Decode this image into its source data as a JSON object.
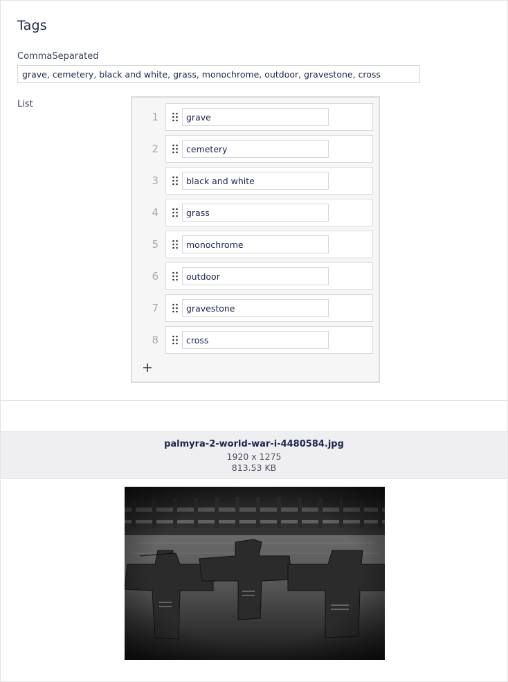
{
  "tags": {
    "title": "Tags",
    "comma_label": "CommaSeparated",
    "comma_value": "grave, cemetery, black and white, grass, monochrome, outdoor, gravestone, cross",
    "list_label": "List",
    "items": [
      {
        "index": "1",
        "value": "grave"
      },
      {
        "index": "2",
        "value": "cemetery"
      },
      {
        "index": "3",
        "value": "black and white"
      },
      {
        "index": "4",
        "value": "grass"
      },
      {
        "index": "5",
        "value": "monochrome"
      },
      {
        "index": "6",
        "value": "outdoor"
      },
      {
        "index": "7",
        "value": "gravestone"
      },
      {
        "index": "8",
        "value": "cross"
      }
    ],
    "add_icon": "plus-icon",
    "drag_icon": "drag-handle-icon"
  },
  "file": {
    "name": "palmyra-2-world-war-i-4480584.jpg",
    "dimensions": "1920 x 1275",
    "size": "813.53 KB"
  },
  "colors": {
    "text": "#1b264f",
    "border": "#d6d6d6",
    "list_bg": "#f6f6f6",
    "file_info_bg": "#efeff1"
  }
}
